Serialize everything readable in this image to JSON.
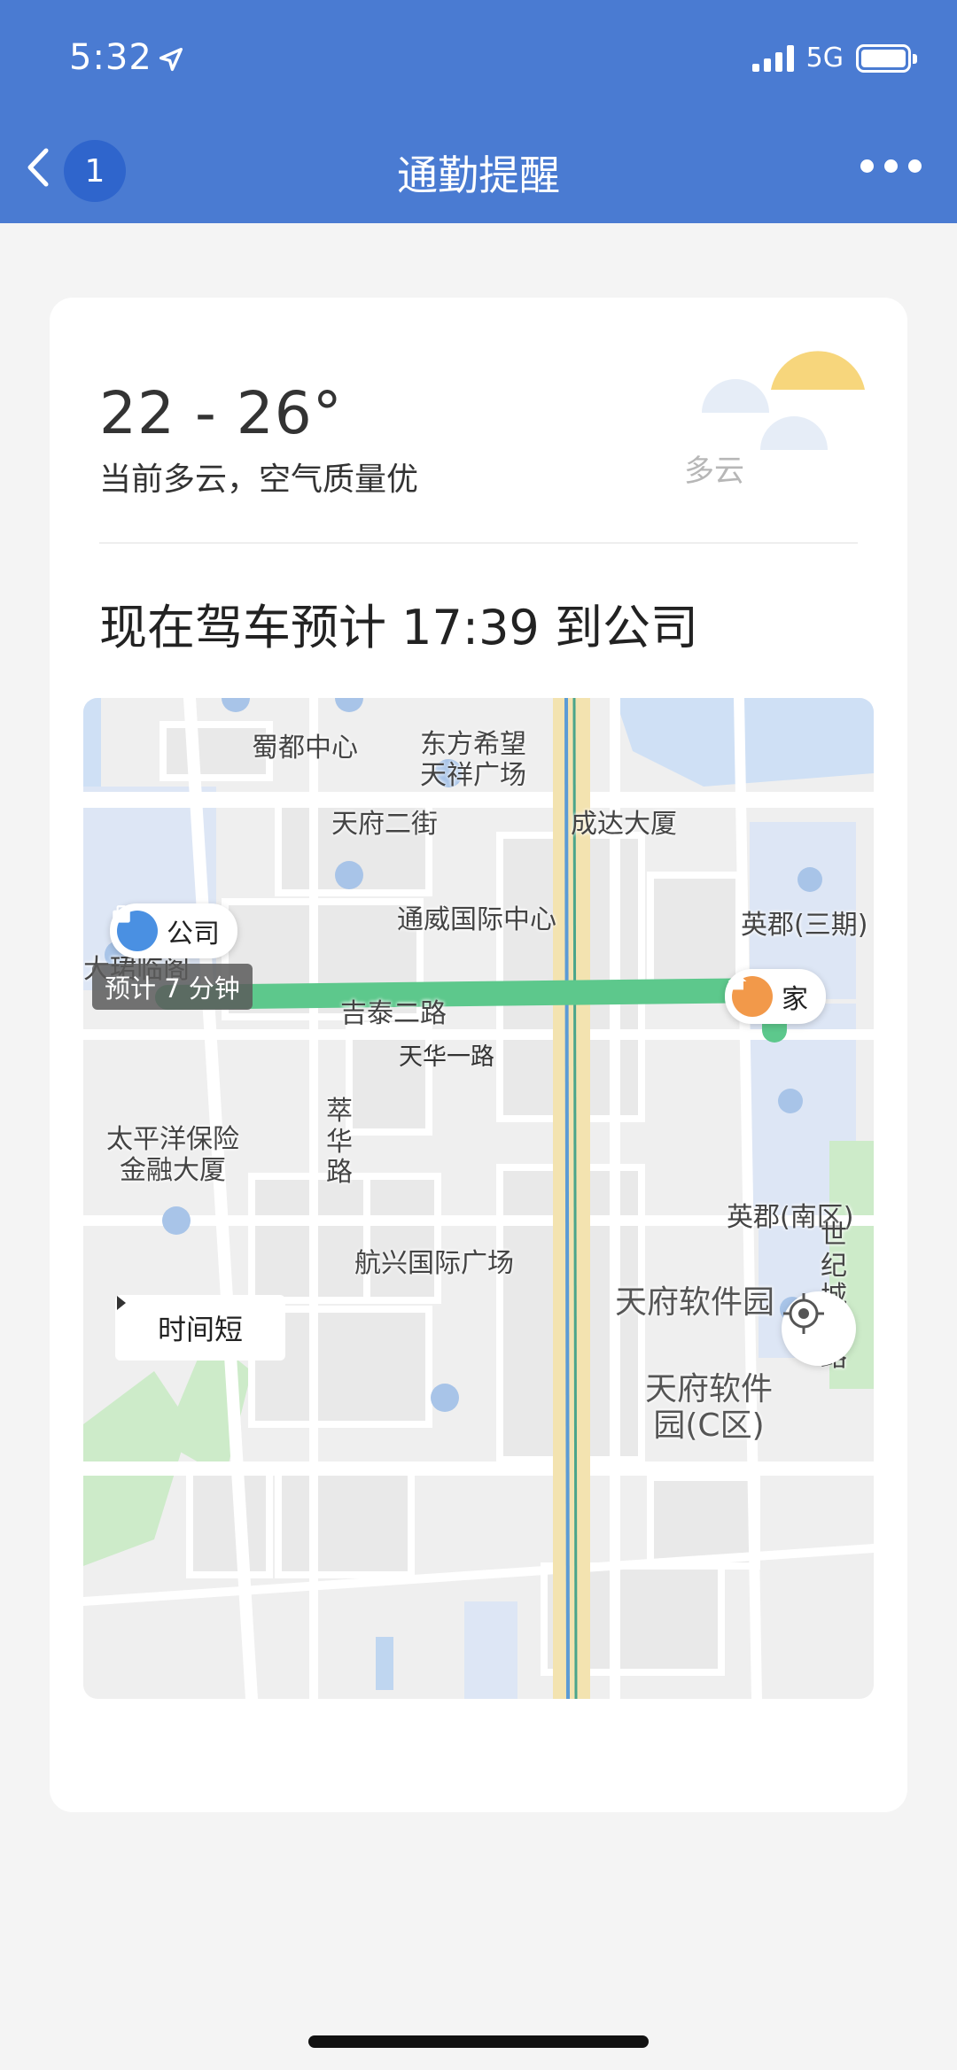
{
  "status_bar": {
    "time": "5:32",
    "network": "5G"
  },
  "nav": {
    "back_badge": "1",
    "title": "通勤提醒"
  },
  "weather": {
    "temperature": "22 - 26°",
    "description": "当前多云，空气质量优",
    "condition": "多云"
  },
  "commute": {
    "eta_text": "现在驾车预计 17:39 到公司"
  },
  "map": {
    "labels": {
      "shudu": "蜀都中心",
      "dongfang": "东方希望\n天祥广场",
      "tianfu2": "天府二街",
      "chengda": "成达大厦",
      "tongwei": "通威国际中心",
      "yingjun3": "英郡(三期)",
      "dazhu": "大珺临阁",
      "jitai": "吉泰二路",
      "tianhua": "天华一路",
      "cuihua": "萃华路",
      "taipingyang": "太平洋保险\n金融大厦",
      "yingjun_south": "英郡(南区)",
      "hangxing": "航兴国际广场",
      "shiji": "世纪城南路",
      "software_park": "天府软件园",
      "software_c": "天府软件\n园(C区)"
    },
    "company_pin": "公司",
    "home_pin": "家",
    "eta_tag": "预计 7 分钟",
    "route_option": "时间短"
  },
  "colors": {
    "header": "#4a7bd2",
    "route": "#5dc88c",
    "home_pin": "#f2994a",
    "company_pin": "#4a90e2"
  },
  "icons": [
    "location-arrow-icon",
    "signal-icon",
    "battery-icon",
    "back-icon",
    "more-icon",
    "sun-cloud-icon",
    "briefcase-icon",
    "home-icon",
    "locate-icon",
    "caret-right-icon"
  ]
}
